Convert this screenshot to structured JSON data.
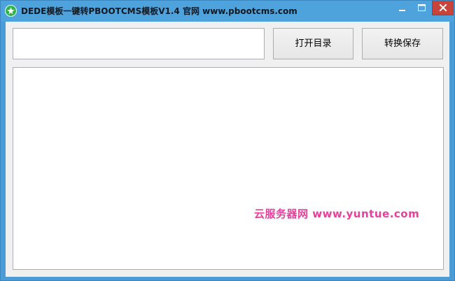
{
  "window": {
    "title": "DEDE模板一键转PBOOTCMS模板V1.4  官网 www.pbootcms.com",
    "icon": "green-leaf-app-icon",
    "controls": {
      "minimize_icon": "minimize-icon",
      "maximize_icon": "maximize-icon",
      "close_icon": "close-icon"
    }
  },
  "toolbar": {
    "path_value": "",
    "open_dir_label": "打开目录",
    "convert_save_label": "转换保存"
  },
  "output": {
    "content": ""
  },
  "watermark": {
    "text": "云服务器网 www.yuntue.com",
    "color": "#e8409a"
  },
  "colors": {
    "titlebar": "#4fa3dc",
    "close_button": "#c8433a",
    "client_bg": "#f0f0f0"
  }
}
